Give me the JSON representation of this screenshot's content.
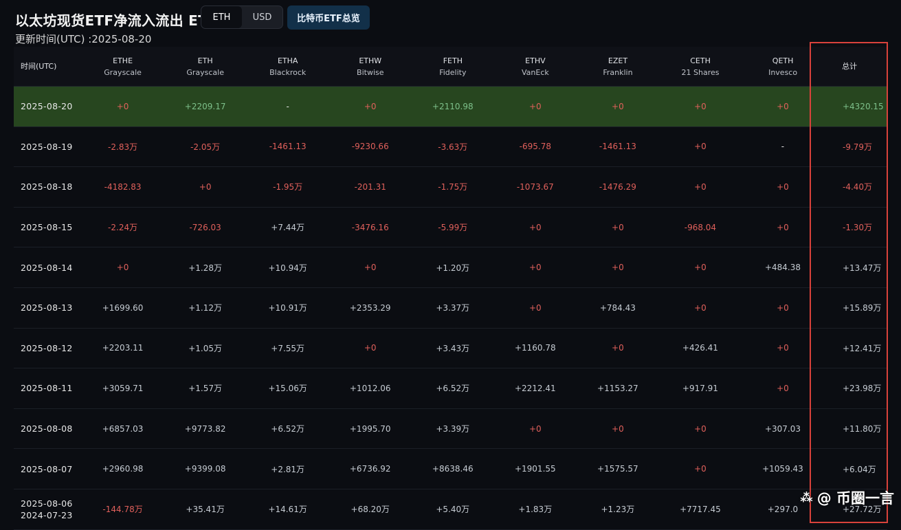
{
  "header": {
    "title": "以太坊现货ETF净流入流出 ETH",
    "updated": "更新时间(UTC) :2025-08-20",
    "toggle_eth": "ETH",
    "toggle_usd": "USD",
    "btc_button": "比特币ETF总览"
  },
  "table": {
    "date_header": "时间(UTC)",
    "total_header": "总计",
    "columns": [
      {
        "ticker": "ETHE",
        "issuer": "Grayscale"
      },
      {
        "ticker": "ETH",
        "issuer": "Grayscale"
      },
      {
        "ticker": "ETHA",
        "issuer": "Blackrock"
      },
      {
        "ticker": "ETHW",
        "issuer": "Bitwise"
      },
      {
        "ticker": "FETH",
        "issuer": "Fidelity"
      },
      {
        "ticker": "ETHV",
        "issuer": "VanEck"
      },
      {
        "ticker": "EZET",
        "issuer": "Franklin"
      },
      {
        "ticker": "CETH",
        "issuer": "21 Shares"
      },
      {
        "ticker": "QETH",
        "issuer": "Invesco"
      }
    ],
    "rows": [
      {
        "date": "2025-08-20",
        "values": [
          "+0",
          "+2209.17",
          "-",
          "+0",
          "+2110.98",
          "+0",
          "+0",
          "+0",
          "+0"
        ],
        "total": "+4320.15"
      },
      {
        "date": "2025-08-19",
        "values": [
          "-2.83万",
          "-2.05万",
          "-1461.13",
          "-9230.66",
          "-3.63万",
          "-695.78",
          "-1461.13",
          "+0",
          "-"
        ],
        "total": "-9.79万"
      },
      {
        "date": "2025-08-18",
        "values": [
          "-4182.83",
          "+0",
          "-1.95万",
          "-201.31",
          "-1.75万",
          "-1073.67",
          "-1476.29",
          "+0",
          "+0"
        ],
        "total": "-4.40万"
      },
      {
        "date": "2025-08-15",
        "values": [
          "-2.24万",
          "-726.03",
          "+7.44万",
          "-3476.16",
          "-5.99万",
          "+0",
          "+0",
          "-968.04",
          "+0"
        ],
        "total": "-1.30万"
      },
      {
        "date": "2025-08-14",
        "values": [
          "+0",
          "+1.28万",
          "+10.94万",
          "+0",
          "+1.20万",
          "+0",
          "+0",
          "+0",
          "+484.38"
        ],
        "total": "+13.47万"
      },
      {
        "date": "2025-08-13",
        "values": [
          "+1699.60",
          "+1.12万",
          "+10.91万",
          "+2353.29",
          "+3.37万",
          "+0",
          "+784.43",
          "+0",
          "+0"
        ],
        "total": "+15.89万"
      },
      {
        "date": "2025-08-12",
        "values": [
          "+2203.11",
          "+1.05万",
          "+7.55万",
          "+0",
          "+3.43万",
          "+1160.78",
          "+0",
          "+426.41",
          "+0"
        ],
        "total": "+12.41万"
      },
      {
        "date": "2025-08-11",
        "values": [
          "+3059.71",
          "+1.57万",
          "+15.06万",
          "+1012.06",
          "+6.52万",
          "+2212.41",
          "+1153.27",
          "+917.91",
          "+0"
        ],
        "total": "+23.98万"
      },
      {
        "date": "2025-08-08",
        "values": [
          "+6857.03",
          "+9773.82",
          "+6.52万",
          "+1995.70",
          "+3.39万",
          "+0",
          "+0",
          "+0",
          "+307.03"
        ],
        "total": "+11.80万"
      },
      {
        "date": "2025-08-07",
        "values": [
          "+2960.98",
          "+9399.08",
          "+2.81万",
          "+6736.92",
          "+8638.46",
          "+1901.55",
          "+1575.57",
          "+0",
          "+1059.43"
        ],
        "total": "+6.04万"
      }
    ],
    "last_row": {
      "date_start": "2025-08-06",
      "date_end": "2024-07-23",
      "values": [
        "-144.78万",
        "+35.41万",
        "+14.61万",
        "+68.20万",
        "+5.40万",
        "+1.83万",
        "+1.23万",
        "+7717.45",
        "+297.0"
      ],
      "total": "+27.72万"
    }
  },
  "watermark": {
    "text": "@ 币圈一言",
    "icon": "diamond-logo-icon"
  },
  "colors": {
    "background": "#0b0d12",
    "highlight_row": "#27461f",
    "negative": "#e0605b",
    "positive": "#c6ccd3",
    "box_outline": "#d9423b"
  }
}
